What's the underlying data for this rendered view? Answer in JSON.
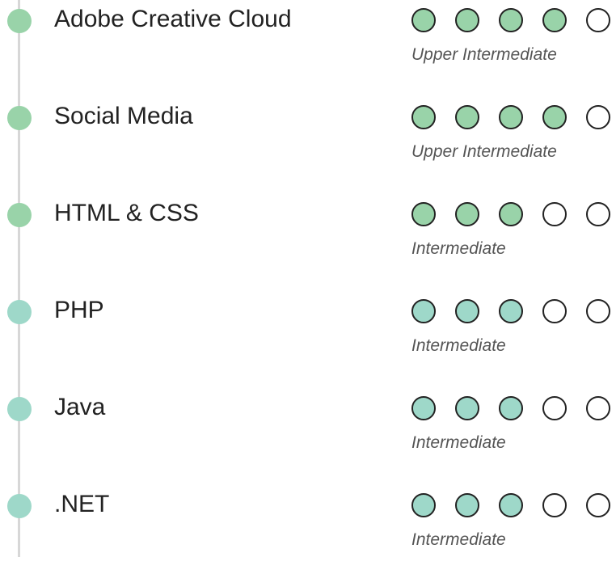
{
  "colors": {
    "green": "#99d3a9",
    "teal": "#9ed8c9",
    "empty": "#ffffff",
    "outline": "#222222",
    "timeline": "#d7d7d7"
  },
  "skills": [
    {
      "name": "Adobe Creative Cloud",
      "rating": 4,
      "max": 5,
      "level": "Upper Intermediate",
      "color": "green"
    },
    {
      "name": "Social Media",
      "rating": 4,
      "max": 5,
      "level": "Upper Intermediate",
      "color": "green"
    },
    {
      "name": "HTML & CSS",
      "rating": 3,
      "max": 5,
      "level": "Intermediate",
      "color": "green"
    },
    {
      "name": "PHP",
      "rating": 3,
      "max": 5,
      "level": "Intermediate",
      "color": "teal"
    },
    {
      "name": "Java",
      "rating": 3,
      "max": 5,
      "level": "Intermediate",
      "color": "teal"
    },
    {
      "name": ".NET",
      "rating": 3,
      "max": 5,
      "level": "Intermediate",
      "color": "teal"
    }
  ]
}
